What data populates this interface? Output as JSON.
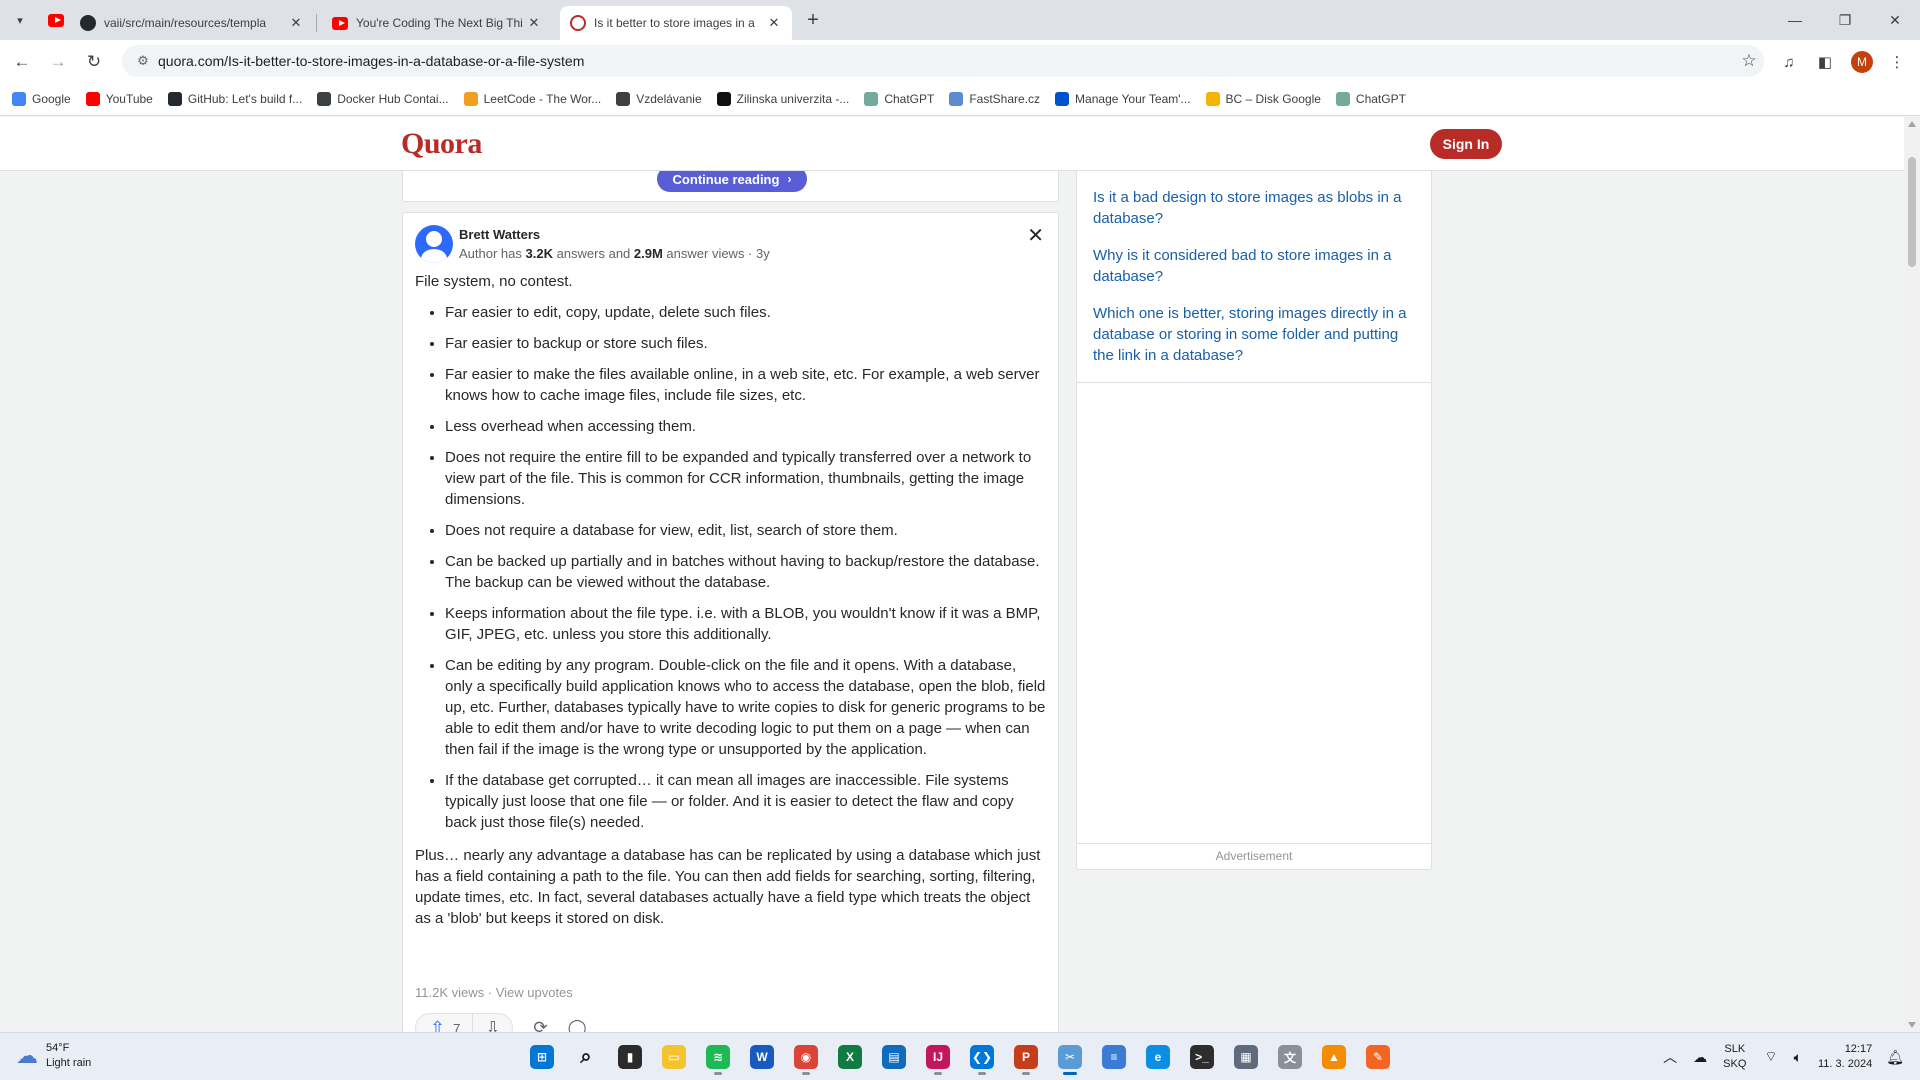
{
  "browser": {
    "tabs": [
      {
        "title": "vaii/src/main/resources/templa",
        "favicon": "github-icon",
        "active": false
      },
      {
        "title": "You're Coding The Next Big Thi",
        "favicon": "youtube-icon",
        "active": false
      },
      {
        "title": "Is it better to store images in a",
        "favicon": "quora-icon",
        "active": true
      }
    ],
    "url": "quora.com/Is-it-better-to-store-images-in-a-database-or-a-file-system",
    "profile_initial": "M",
    "bookmarks": [
      {
        "label": "Google",
        "icon": "google-icon",
        "color": "#4285f4"
      },
      {
        "label": "YouTube",
        "icon": "youtube-icon",
        "color": "#ff0000"
      },
      {
        "label": "GitHub: Let's build f...",
        "icon": "github-icon",
        "color": "#24292f"
      },
      {
        "label": "Docker Hub Contai...",
        "icon": "docker-icon",
        "color": "#3c4043"
      },
      {
        "label": "LeetCode - The Wor...",
        "icon": "leetcode-icon",
        "color": "#f0a020"
      },
      {
        "label": "Vzdelávanie",
        "icon": "graduation-icon",
        "color": "#3c4043"
      },
      {
        "label": "Zilinska univerzita -...",
        "icon": "university-icon",
        "color": "#111111"
      },
      {
        "label": "ChatGPT",
        "icon": "chatgpt-icon",
        "color": "#74aa9c"
      },
      {
        "label": "FastShare.cz",
        "icon": "fastshare-icon",
        "color": "#5b8bd0"
      },
      {
        "label": "Manage Your Team'...",
        "icon": "trello-icon",
        "color": "#0052cc"
      },
      {
        "label": "BC – Disk Google",
        "icon": "google-drive-icon",
        "color": "#f4b400"
      },
      {
        "label": "ChatGPT",
        "icon": "chatgpt-icon",
        "color": "#74aa9c"
      }
    ]
  },
  "quora": {
    "logo": "Quora",
    "sign_in": "Sign In",
    "continue_reading": "Continue reading",
    "answer": {
      "author": "Brett Watters",
      "cred_prefix": "Author has ",
      "answers_count": "3.2K",
      "cred_mid": " answers and ",
      "views_count": "2.9M",
      "cred_suffix": " answer views · 3y",
      "lead": "File system, no contest.",
      "bullets": [
        "Far easier to edit, copy, update, delete such files.",
        "Far easier to backup or store such files.",
        "Far easier to make the files available online, in a web site, etc. For example, a web server knows how to cache image files, include file sizes, etc.",
        "Less overhead when accessing them.",
        "Does not require the entire fill to be expanded and typically transferred over a network to view part of the file. This is common for CCR information, thumbnails, getting the image dimensions.",
        "Does not require a database for view, edit, list, search of store them.",
        "Can be backed up partially and in batches without having to backup/restore the database. The backup can be viewed without the database.",
        "Keeps information about the file type. i.e. with a BLOB, you wouldn't know if it was a BMP, GIF, JPEG, etc. unless you store this additionally.",
        "Can be editing by any program. Double-click on the file and it opens. With a database, only a specifically build application knows who to access the database, open the blob, field up, etc. Further, databases typically have to write copies to disk for generic programs to be able to edit them and/or have to write decoding logic to put them on a page — when can then fail if the image is the wrong type or unsupported by the application.",
        "If the database get corrupted… it can mean all images are inaccessible. File systems typically just loose that one file — or folder. And it is easier to detect the flaw and copy back just those file(s) needed."
      ],
      "closing": "Plus… nearly any advantage a database has can be replicated by using a database which just has a field containing a path to the file. You can then add fields for searching, sorting, filtering, update times, etc. In fact, several databases actually have a field type which treats the object as a 'blob' but keeps it stored on disk.",
      "views": "11.2K views",
      "view_upvotes": "View upvotes",
      "upvotes": "7"
    },
    "related": [
      "Is it a bad design to store images as blobs in a database?",
      "Why is it considered bad to store images in a database?",
      "Which one is better, storing images directly in a database or storing in some folder and putting the link in a database?"
    ],
    "ad_label": "Advertisement"
  },
  "taskbar": {
    "weather_temp": "54°F",
    "weather_desc": "Light rain",
    "lang_top": "SLK",
    "lang_bottom": "SKQ",
    "time": "12:17",
    "date": "11. 3. 2024",
    "apps": [
      {
        "name": "start-icon",
        "color": "#0078d4",
        "glyph": "⊞"
      },
      {
        "name": "search-icon",
        "color": "transparent",
        "glyph": "⌕"
      },
      {
        "name": "task-view-icon",
        "color": "#2b2b2b",
        "glyph": "▮"
      },
      {
        "name": "file-explorer-icon",
        "color": "#f4c430",
        "glyph": "▭"
      },
      {
        "name": "spotify-icon",
        "color": "#1db954",
        "glyph": "≋"
      },
      {
        "name": "word-icon",
        "color": "#185abd",
        "glyph": "W"
      },
      {
        "name": "chrome-icon",
        "color": "#db4437",
        "glyph": "◉"
      },
      {
        "name": "excel-icon",
        "color": "#107c41",
        "glyph": "X"
      },
      {
        "name": "store-icon",
        "color": "#0f6cbd",
        "glyph": "▤"
      },
      {
        "name": "intellij-icon",
        "color": "#c2185b",
        "glyph": "IJ"
      },
      {
        "name": "vscode-icon",
        "color": "#0078d7",
        "glyph": "❮❯"
      },
      {
        "name": "powerpoint-icon",
        "color": "#c43e1c",
        "glyph": "P"
      },
      {
        "name": "snipping-tool-icon",
        "color": "#5a9bd5",
        "glyph": "✂"
      },
      {
        "name": "notepad-icon",
        "color": "#3a7bd5",
        "glyph": "≡"
      },
      {
        "name": "edge-icon",
        "color": "#0c8ee4",
        "glyph": "e"
      },
      {
        "name": "terminal-icon",
        "color": "#2d2d2d",
        "glyph": ">_"
      },
      {
        "name": "calculator-icon",
        "color": "#5f6b7a",
        "glyph": "▦"
      },
      {
        "name": "translator-icon",
        "color": "#8a8f98",
        "glyph": "文"
      },
      {
        "name": "vlc-icon",
        "color": "#f48c06",
        "glyph": "▲"
      },
      {
        "name": "brave-icon",
        "color": "#f26522",
        "glyph": "✎"
      }
    ]
  }
}
